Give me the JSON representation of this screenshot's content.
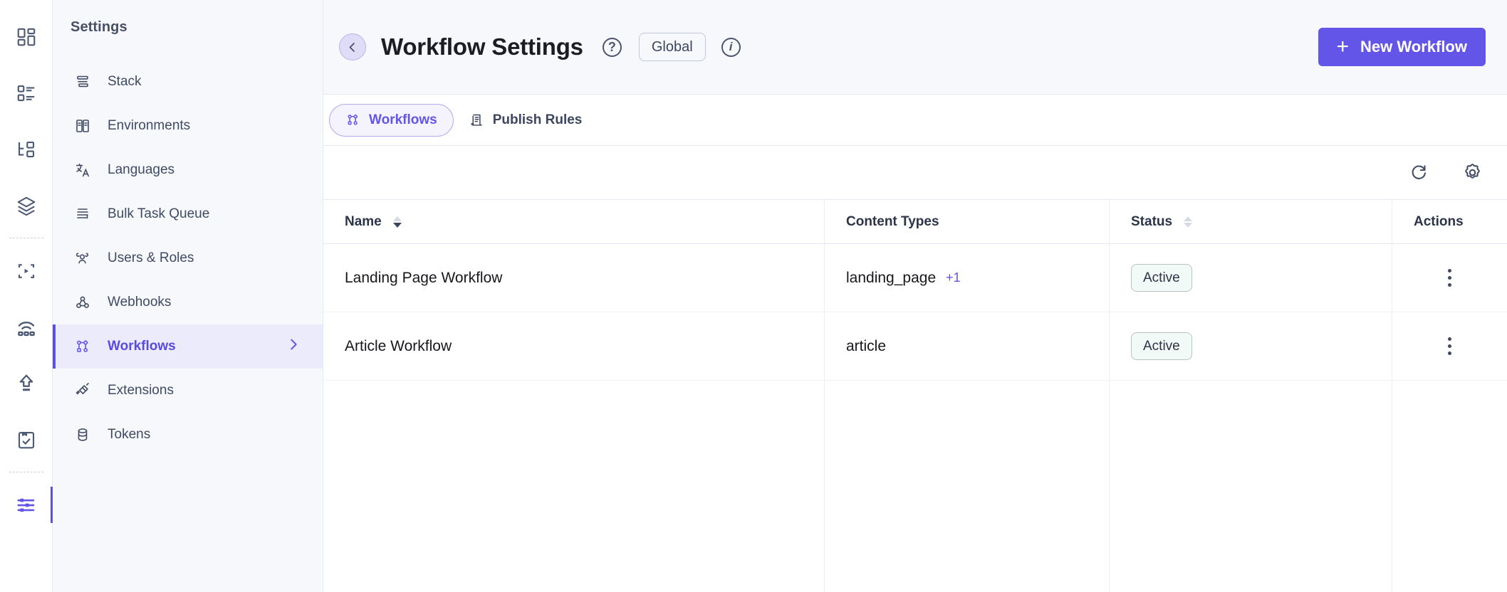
{
  "rail": {
    "items": [
      {
        "name": "dashboard-icon",
        "label": "Dashboard"
      },
      {
        "name": "content-types-icon",
        "label": "Content Types"
      },
      {
        "name": "entries-icon",
        "label": "Entries"
      },
      {
        "name": "assets-icon",
        "label": "Assets"
      },
      {
        "name": "live-preview-icon",
        "label": "Live Preview"
      },
      {
        "name": "releases-icon",
        "label": "Releases"
      },
      {
        "name": "publish-icon",
        "label": "Publish Queue"
      },
      {
        "name": "tasks-icon",
        "label": "Tasks"
      },
      {
        "name": "settings-icon",
        "label": "Settings"
      }
    ]
  },
  "sidebar": {
    "title": "Settings",
    "items": [
      {
        "label": "Stack",
        "icon": "stack-icon"
      },
      {
        "label": "Environments",
        "icon": "environments-icon"
      },
      {
        "label": "Languages",
        "icon": "languages-icon"
      },
      {
        "label": "Bulk Task Queue",
        "icon": "bulk-task-queue-icon"
      },
      {
        "label": "Users & Roles",
        "icon": "users-roles-icon"
      },
      {
        "label": "Webhooks",
        "icon": "webhooks-icon"
      },
      {
        "label": "Workflows",
        "icon": "workflows-icon"
      },
      {
        "label": "Extensions",
        "icon": "extensions-icon"
      },
      {
        "label": "Tokens",
        "icon": "tokens-icon"
      }
    ],
    "active_label": "Workflows"
  },
  "header": {
    "back_label": "Back",
    "title": "Workflow Settings",
    "help_glyph": "?",
    "scope_badge": "Global",
    "info_glyph": "i",
    "new_workflow_label": "New Workflow",
    "plus_glyph": "+"
  },
  "tabs": [
    {
      "label": "Workflows",
      "icon": "workflows-icon",
      "active": true
    },
    {
      "label": "Publish Rules",
      "icon": "publish-rules-icon",
      "active": false
    }
  ],
  "toolbar": {
    "refresh_label": "Refresh",
    "settings_label": "Table settings"
  },
  "table": {
    "columns": [
      {
        "label": "Name",
        "sortable": true,
        "sort": "desc"
      },
      {
        "label": "Content Types",
        "sortable": false,
        "sort": "none"
      },
      {
        "label": "Status",
        "sortable": true,
        "sort": "none"
      },
      {
        "label": "Actions",
        "sortable": false,
        "sort": "none"
      }
    ],
    "rows": [
      {
        "name": "Landing Page Workflow",
        "content_type": "landing_page",
        "extra_count": "+1",
        "status": "Active"
      },
      {
        "name": "Article Workflow",
        "content_type": "article",
        "extra_count": "",
        "status": "Active"
      }
    ]
  },
  "colors": {
    "accent": "#6355e8",
    "accent_soft": "#ecebfb",
    "sidebar_bg": "#f7f8fc",
    "border": "#e6e8ef",
    "text": "#2c3449",
    "status_bg": "#f2faf7"
  }
}
